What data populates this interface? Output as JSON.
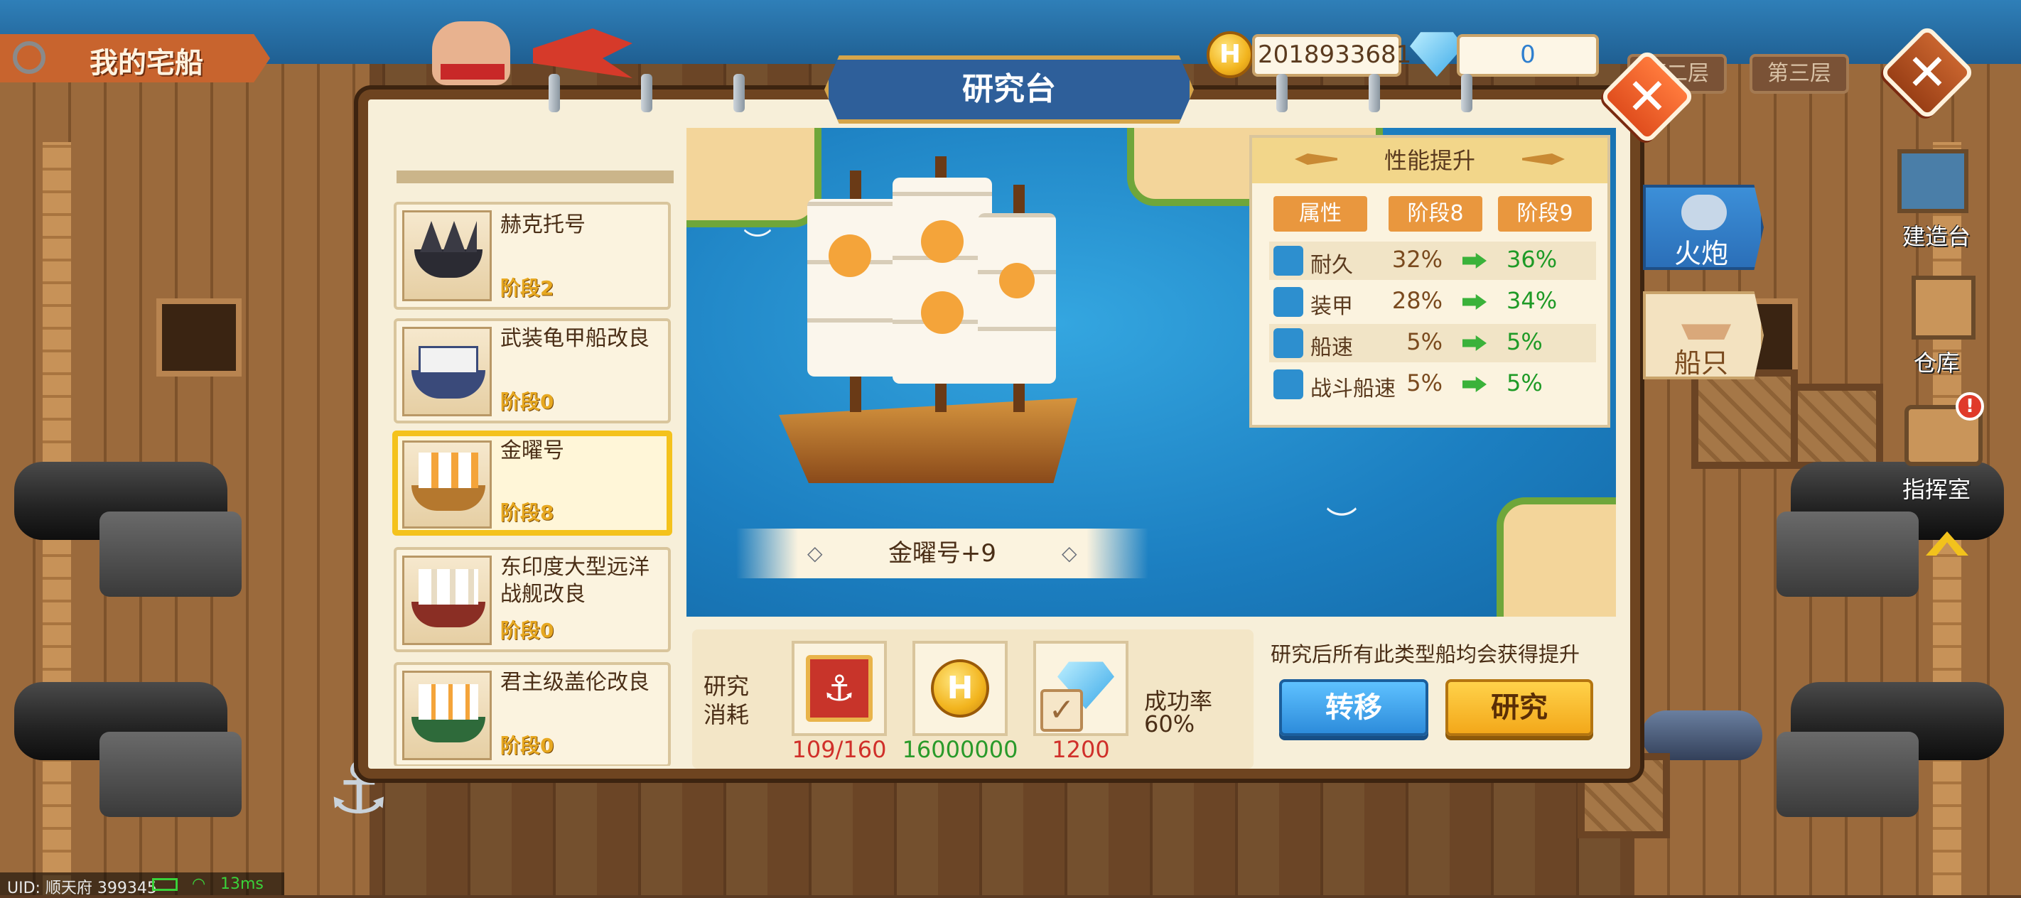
{
  "top_left": {
    "label": "我的宅船"
  },
  "currency": {
    "gold": "2018933681",
    "diamond": "0",
    "gold_glyph": "H"
  },
  "floor_tabs": [
    "第二层",
    "第三层"
  ],
  "panel": {
    "title": "研究台"
  },
  "ship_list": [
    {
      "name": "赫克托号",
      "stage": "阶段2",
      "selected": false
    },
    {
      "name": "武装龟甲船改良",
      "stage": "阶段0",
      "selected": false
    },
    {
      "name": "金曜号",
      "stage": "阶段8",
      "selected": true
    },
    {
      "name": "东印度大型远洋战舰改良",
      "stage": "阶段0",
      "selected": false
    },
    {
      "name": "君主级盖伦改良",
      "stage": "阶段0",
      "selected": false
    }
  ],
  "ship_display": {
    "name": "金曜号+9"
  },
  "stats": {
    "title": "性能提升",
    "columns": [
      "属性",
      "阶段8",
      "阶段9"
    ],
    "rows": [
      {
        "label": "耐久",
        "current": "32%",
        "next": "36%",
        "icon": "magnifier-icon"
      },
      {
        "label": "装甲",
        "current": "28%",
        "next": "34%",
        "icon": "armor-icon"
      },
      {
        "label": "船速",
        "current": "5%",
        "next": "5%",
        "icon": "ship-speed-icon"
      },
      {
        "label": "战斗船速",
        "current": "5%",
        "next": "5%",
        "icon": "battle-speed-icon"
      }
    ]
  },
  "cost": {
    "label": "研究消耗",
    "items": [
      {
        "name": "research-book",
        "amount": "109/160",
        "color": "#d0302a"
      },
      {
        "name": "gold-coin",
        "amount": "16000000",
        "color": "#2a9a2a"
      },
      {
        "name": "diamond",
        "amount": "1200",
        "color": "#d0302a"
      }
    ],
    "success_label": "成功率",
    "success_rate": "60%"
  },
  "notice": "研究后所有此类型船均会获得提升",
  "buttons": {
    "transfer": "转移",
    "research": "研究"
  },
  "side_tabs": [
    {
      "label": "火炮",
      "active": true
    },
    {
      "label": "船只",
      "active": false
    }
  ],
  "right_menu": [
    "建造台",
    "仓库",
    "指挥室"
  ],
  "status_bar": {
    "uid": "UID: 顺天府 399345",
    "ping": "13ms"
  }
}
